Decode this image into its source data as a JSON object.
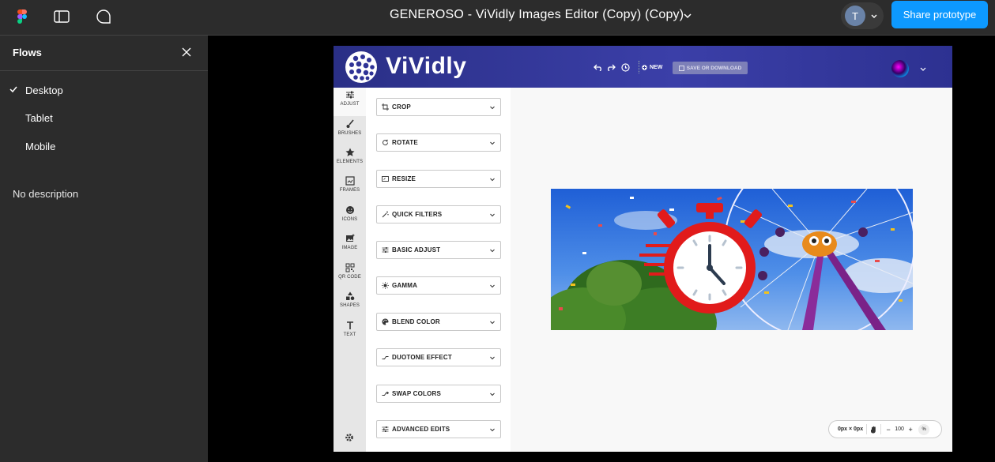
{
  "figma": {
    "document_title": "GENEROSO - ViVidly Images Editor (Copy) (Copy)",
    "user_initial": "T",
    "share_button": "Share prototype",
    "accent": "#0d99ff"
  },
  "flows": {
    "title": "Flows",
    "items": [
      {
        "label": "Desktop",
        "selected": true
      },
      {
        "label": "Tablet",
        "selected": false
      },
      {
        "label": "Mobile",
        "selected": false
      }
    ],
    "description": "No description"
  },
  "vividly": {
    "brand": "ViVidly",
    "new_label": "NEW",
    "save_label": "SAVE OR DOWNLOAD",
    "header_color": "#2f3396",
    "rail": [
      {
        "label": "ADJUST",
        "icon": "sliders-icon"
      },
      {
        "label": "BRUSHES",
        "icon": "brush-icon"
      },
      {
        "label": "ELEMENTS",
        "icon": "star-icon"
      },
      {
        "label": "FRAMES",
        "icon": "frame-icon"
      },
      {
        "label": "ICONS",
        "icon": "smiley-icon"
      },
      {
        "label": "IMAGE",
        "icon": "image-icon"
      },
      {
        "label": "QR CODE",
        "icon": "qr-code-icon"
      },
      {
        "label": "SHAPES",
        "icon": "shapes-icon"
      },
      {
        "label": "TEXT",
        "icon": "text-icon"
      }
    ],
    "options": [
      {
        "label": "CROP",
        "icon": "crop-icon"
      },
      {
        "label": "ROTATE",
        "icon": "rotate-icon"
      },
      {
        "label": "RESIZE",
        "icon": "resize-icon"
      },
      {
        "label": "QUICK FILTERS",
        "icon": "magic-wand-icon"
      },
      {
        "label": "BASIC ADJUST",
        "icon": "sliders-icon"
      },
      {
        "label": "GAMMA",
        "icon": "sun-icon"
      },
      {
        "label": "BLEND COLOR",
        "icon": "palette-icon"
      },
      {
        "label": "DUOTONE EFFECT",
        "icon": "duotone-icon"
      },
      {
        "label": "SWAP COLORS",
        "icon": "swap-icon"
      },
      {
        "label": "ADVANCED EDITS",
        "icon": "sliders-icon"
      }
    ],
    "zoom": {
      "size": "0px × 0px",
      "minus": "−",
      "value": "100",
      "plus": "+",
      "unit": "%"
    }
  }
}
